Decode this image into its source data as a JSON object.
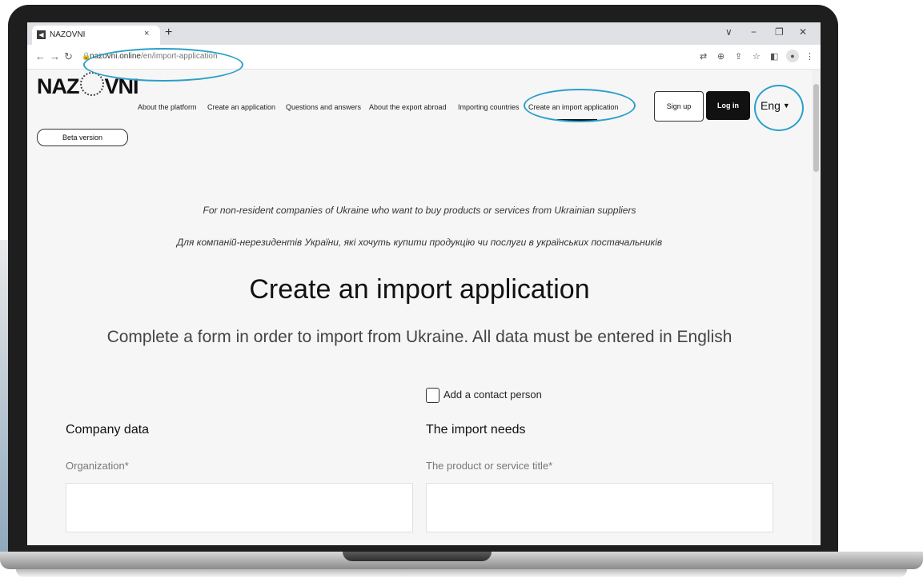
{
  "browser": {
    "tab_title": "NAZOVNI",
    "tab_close": "×",
    "new_tab": "+",
    "url_host": "nazovni.online",
    "url_path": "/en/import-application",
    "window_controls": [
      "∨",
      "−",
      "❐",
      "✕"
    ]
  },
  "header": {
    "logo": "NAZOVNI",
    "nav": [
      "About the platform",
      "Create an application",
      "Questions and answers",
      "About the export abroad",
      "Importing countries",
      "Create an import application"
    ],
    "signup": "Sign up",
    "login": "Log in",
    "language": "Eng",
    "beta": "Beta version"
  },
  "main": {
    "intro_en": "For non-resident companies of Ukraine who want to buy products or services from Ukrainian suppliers",
    "intro_uk": "Для компаній-нерезидентів України, які хочуть купити продукцію чи послуги в українських постачальників",
    "title": "Create an import application",
    "subtitle": "Complete a form in order to import from Ukraine. All data must be entered in English",
    "add_contact": "Add a contact person",
    "company_section": "Company data",
    "needs_section": "The import needs",
    "organization_label": "Organization*",
    "product_label": "The product or service title*"
  },
  "colors": {
    "highlight": "#2a9fc9",
    "login_button": "#111111"
  }
}
